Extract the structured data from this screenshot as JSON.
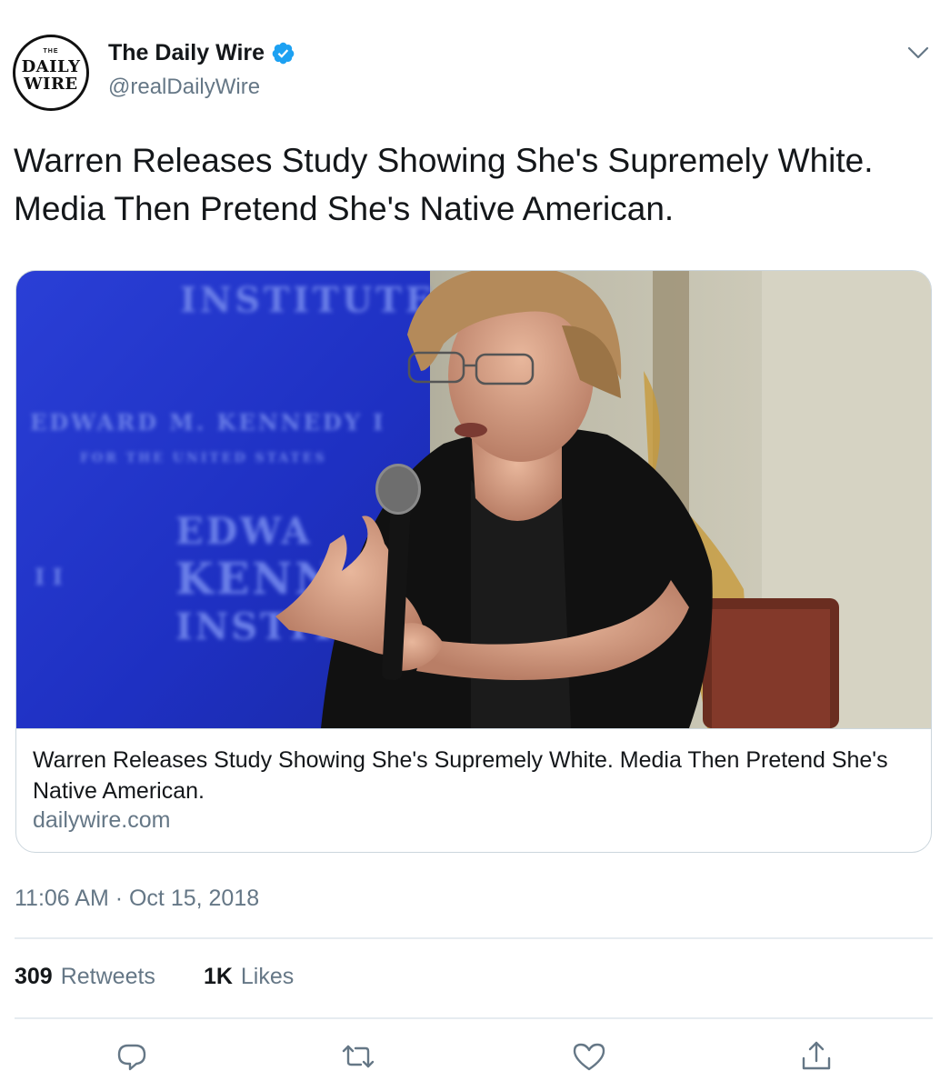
{
  "account": {
    "display_name": "The Daily Wire",
    "handle": "@realDailyWire",
    "logo_top": "THE",
    "logo_line1": "DAILY",
    "logo_line2": "WIRE"
  },
  "tweet": {
    "text": "Warren Releases Study Showing She's Supremely White. Media Then Pretend She's Native American.",
    "timestamp": "11:06 AM · Oct 15, 2018"
  },
  "card": {
    "title": "Warren Releases Study Showing She's Supremely White. Media Then Pretend She's Native American.",
    "domain": "dailywire.com",
    "image_backdrop_text": [
      "INSTITUTE",
      "EDWARD M. KENNEDY INSTITUTE",
      "FOR THE UNITED STATES SENATE",
      "EDWARD",
      "KENNEDY",
      "INSTITUTE"
    ]
  },
  "stats": {
    "retweets_count": "309",
    "retweets_label": "Retweets",
    "likes_count": "1K",
    "likes_label": "Likes"
  },
  "icons": {
    "verified": "verified-badge-icon",
    "caret": "chevron-down-icon",
    "reply": "reply-icon",
    "retweet": "retweet-icon",
    "like": "heart-icon",
    "share": "share-icon"
  },
  "colors": {
    "text_primary": "#14171a",
    "text_secondary": "#657786",
    "verified_blue": "#1da1f2",
    "border": "#ccd6dd",
    "divider": "#e6ecf0"
  }
}
